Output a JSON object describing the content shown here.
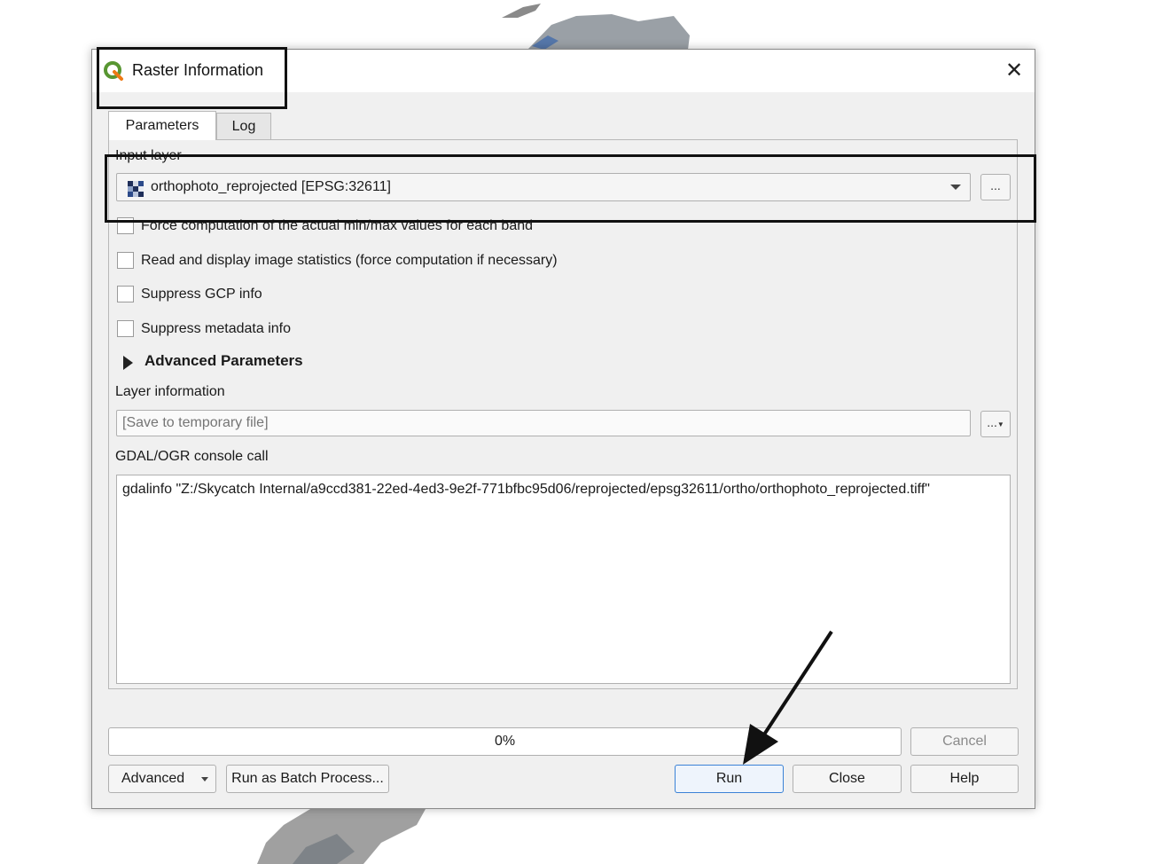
{
  "dialog": {
    "title": "Raster Information",
    "icon": "qgis-logo-icon",
    "close_icon": "close-icon"
  },
  "tabs": [
    {
      "label": "Parameters",
      "active": true
    },
    {
      "label": "Log",
      "active": false
    }
  ],
  "params": {
    "input_layer_label": "Input layer",
    "input_layer_value": "orthophoto_reprojected [EPSG:32611]",
    "browse_label": "...",
    "checkboxes": [
      {
        "label": "Force computation of the actual min/max values for each band",
        "checked": false
      },
      {
        "label": "Read and display image statistics (force computation if necessary)",
        "checked": false
      },
      {
        "label": "Suppress GCP info",
        "checked": false
      },
      {
        "label": "Suppress metadata info",
        "checked": false
      }
    ],
    "advanced_label": "Advanced Parameters",
    "layer_info_label": "Layer information",
    "layer_info_placeholder": "[Save to temporary file]",
    "output_browse_label": "...",
    "console_label": "GDAL/OGR console call",
    "console_text": "gdalinfo \"Z:/Skycatch Internal/a9ccd381-22ed-4ed3-9e2f-771bfbc95d06/reprojected/epsg32611/ortho/orthophoto_reprojected.tiff\""
  },
  "progress": {
    "text": "0%",
    "value": 0
  },
  "buttons": {
    "cancel": "Cancel",
    "advanced": "Advanced",
    "batch": "Run as Batch Process...",
    "run": "Run",
    "close": "Close",
    "help": "Help"
  },
  "colors": {
    "accent": "#3b82d6",
    "qgis_green": "#589632",
    "qgis_yellow": "#ee7913"
  }
}
